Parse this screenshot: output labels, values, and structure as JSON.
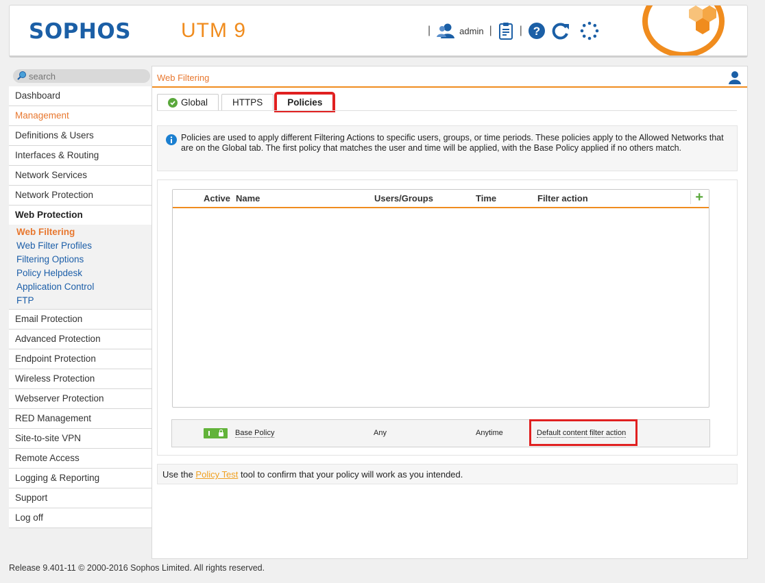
{
  "header": {
    "brand": "SOPHOS",
    "product": "UTM 9",
    "separator": "|",
    "user": "admin",
    "icons": [
      "user-icon",
      "report-icon",
      "help-icon",
      "reload-icon",
      "loading-icon"
    ]
  },
  "sidebar": {
    "search_placeholder": "search",
    "items_top": [
      "Dashboard",
      "Management",
      "Definitions & Users",
      "Interfaces & Routing",
      "Network Services",
      "Network Protection"
    ],
    "group": "Web Protection",
    "sub_items": [
      "Web Filtering",
      "Web Filter Profiles",
      "Filtering Options",
      "Policy Helpdesk",
      "Application Control",
      "FTP"
    ],
    "items_bottom": [
      "Email Protection",
      "Advanced Protection",
      "Endpoint Protection",
      "Wireless Protection",
      "Webserver Protection",
      "RED Management",
      "Site-to-site VPN",
      "Remote Access",
      "Logging & Reporting",
      "Support",
      "Log off"
    ]
  },
  "main": {
    "breadcrumb": "Web Filtering",
    "tabs": [
      {
        "label": "Global"
      },
      {
        "label": "HTTPS"
      },
      {
        "label": "Policies"
      }
    ],
    "info": "Policies are used to apply different Filtering Actions to specific users, groups, or time periods. These policies apply to the Allowed Networks that are on the Global tab. The first policy that matches the user and time will be applied, with the Base Policy applied if no others match.",
    "columns": {
      "active": "Active",
      "name": "Name",
      "users": "Users/Groups",
      "time": "Time",
      "filter": "Filter action",
      "add": "+"
    },
    "base_policy": {
      "name": "Base Policy",
      "users": "Any",
      "time": "Anytime",
      "filter_action": "Default content filter action"
    },
    "tip": {
      "before": "Use the ",
      "link": "Policy Test",
      "after": " tool to confirm that your policy will work as you intended."
    }
  },
  "footer": "Release 9.401-11  © 2000-2016 Sophos Limited. All rights reserved.",
  "colors": {
    "accent": "#f08c1e",
    "brand_blue": "#1b5fa6",
    "link_blue": "#1c5ea8",
    "enabled_green": "#62b33a",
    "highlight_red": "#e02020"
  }
}
